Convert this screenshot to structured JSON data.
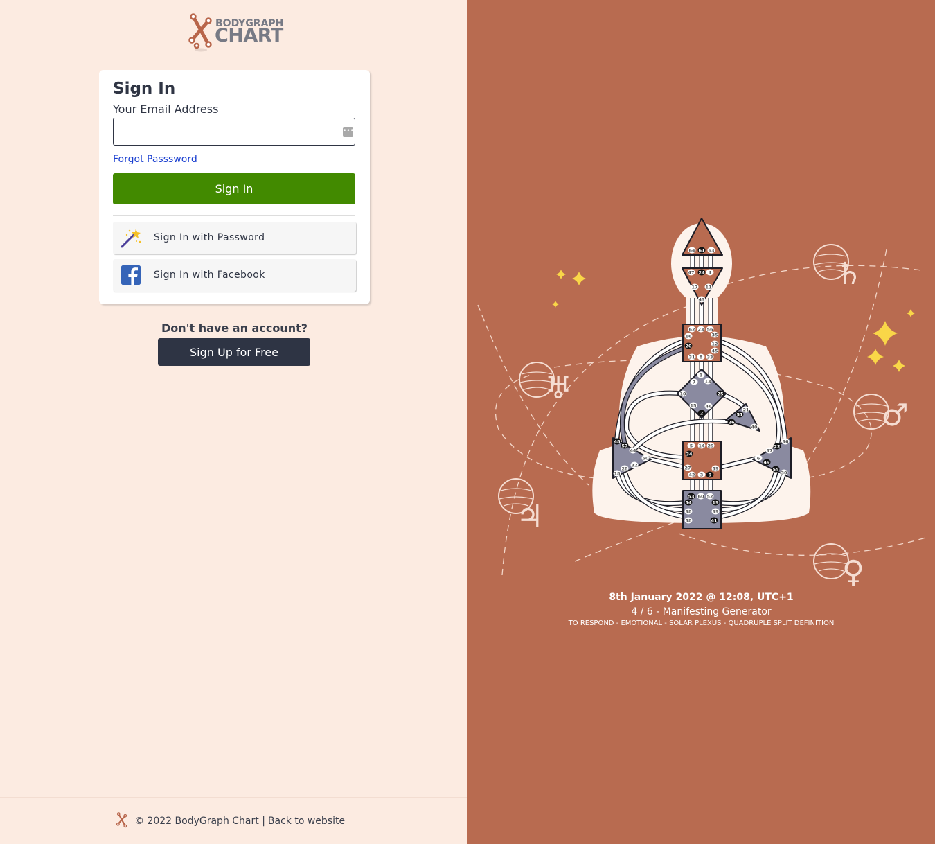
{
  "brand": {
    "line1": "BODYGRAPH",
    "line2": "CHART",
    "color": "#b8654a"
  },
  "signin": {
    "title": "Sign In",
    "email_label": "Your Email Address",
    "email_value": "",
    "email_placeholder": "",
    "forgot_label": "Forgot Passsword",
    "submit_label": "Sign In",
    "password_label": "Sign In with Password",
    "facebook_label": "Sign In with Facebook"
  },
  "signup": {
    "prompt": "Don't have an account?",
    "button_label": "Sign Up for Free"
  },
  "footer": {
    "copyright": "© 2022 BodyGraph Chart |",
    "back_link": "Back to website"
  },
  "chart": {
    "date_line": "8th January 2022 @ 12:08, UTC+1",
    "type_line": "4 / 6 - Manifesting Generator",
    "details_line": "TO RESPOND - EMOTIONAL - SOLAR PLEXUS - QUADRUPLE SPLIT DEFINITION",
    "colors": {
      "defined": "#b86b50",
      "undefined": "#8a8aa0",
      "background": "#b86b50",
      "silhouette": "#fdf3ec",
      "star": "#f9d648"
    },
    "planets": [
      "uranus",
      "saturn",
      "mars",
      "jupiter",
      "venus"
    ],
    "centers": [
      {
        "name": "head",
        "defined": true
      },
      {
        "name": "ajna",
        "defined": true
      },
      {
        "name": "throat",
        "defined": true
      },
      {
        "name": "g",
        "defined": false
      },
      {
        "name": "heart",
        "defined": false
      },
      {
        "name": "sacral",
        "defined": true
      },
      {
        "name": "spleen",
        "defined": false
      },
      {
        "name": "solar-plexus",
        "defined": false
      },
      {
        "name": "root",
        "defined": false
      }
    ],
    "gates": [
      {
        "n": "64",
        "a": false
      },
      {
        "n": "61",
        "a": true
      },
      {
        "n": "63",
        "a": false
      },
      {
        "n": "47",
        "a": false
      },
      {
        "n": "24",
        "a": true
      },
      {
        "n": "4",
        "a": false
      },
      {
        "n": "17",
        "a": false
      },
      {
        "n": "11",
        "a": false
      },
      {
        "n": "43",
        "a": false
      },
      {
        "n": "62",
        "a": false
      },
      {
        "n": "23",
        "a": false
      },
      {
        "n": "56",
        "a": false
      },
      {
        "n": "16",
        "a": false
      },
      {
        "n": "35",
        "a": false
      },
      {
        "n": "20",
        "a": true
      },
      {
        "n": "12",
        "a": false
      },
      {
        "n": "45",
        "a": false
      },
      {
        "n": "31",
        "a": false
      },
      {
        "n": "8",
        "a": false
      },
      {
        "n": "33",
        "a": false
      },
      {
        "n": "1",
        "a": false
      },
      {
        "n": "7",
        "a": false
      },
      {
        "n": "13",
        "a": false
      },
      {
        "n": "10",
        "a": false
      },
      {
        "n": "25",
        "a": true
      },
      {
        "n": "15",
        "a": false
      },
      {
        "n": "46",
        "a": false
      },
      {
        "n": "2",
        "a": true
      },
      {
        "n": "21",
        "a": false
      },
      {
        "n": "51",
        "a": true
      },
      {
        "n": "26",
        "a": true
      },
      {
        "n": "40",
        "a": false
      },
      {
        "n": "5",
        "a": false
      },
      {
        "n": "14",
        "a": false
      },
      {
        "n": "29",
        "a": false
      },
      {
        "n": "34",
        "a": true
      },
      {
        "n": "27",
        "a": false
      },
      {
        "n": "59",
        "a": false
      },
      {
        "n": "42",
        "a": false
      },
      {
        "n": "3",
        "a": false
      },
      {
        "n": "9",
        "a": true
      },
      {
        "n": "48",
        "a": true
      },
      {
        "n": "57",
        "a": true
      },
      {
        "n": "44",
        "a": false
      },
      {
        "n": "50",
        "a": false
      },
      {
        "n": "32",
        "a": false
      },
      {
        "n": "28",
        "a": false
      },
      {
        "n": "18",
        "a": false
      },
      {
        "n": "36",
        "a": false
      },
      {
        "n": "22",
        "a": true
      },
      {
        "n": "37",
        "a": false
      },
      {
        "n": "6",
        "a": false
      },
      {
        "n": "49",
        "a": true
      },
      {
        "n": "55",
        "a": true
      },
      {
        "n": "30",
        "a": false
      },
      {
        "n": "53",
        "a": true
      },
      {
        "n": "60",
        "a": false
      },
      {
        "n": "52",
        "a": false
      },
      {
        "n": "54",
        "a": true
      },
      {
        "n": "19",
        "a": true
      },
      {
        "n": "38",
        "a": false
      },
      {
        "n": "39",
        "a": false
      },
      {
        "n": "58",
        "a": false
      },
      {
        "n": "41",
        "a": true
      }
    ]
  }
}
